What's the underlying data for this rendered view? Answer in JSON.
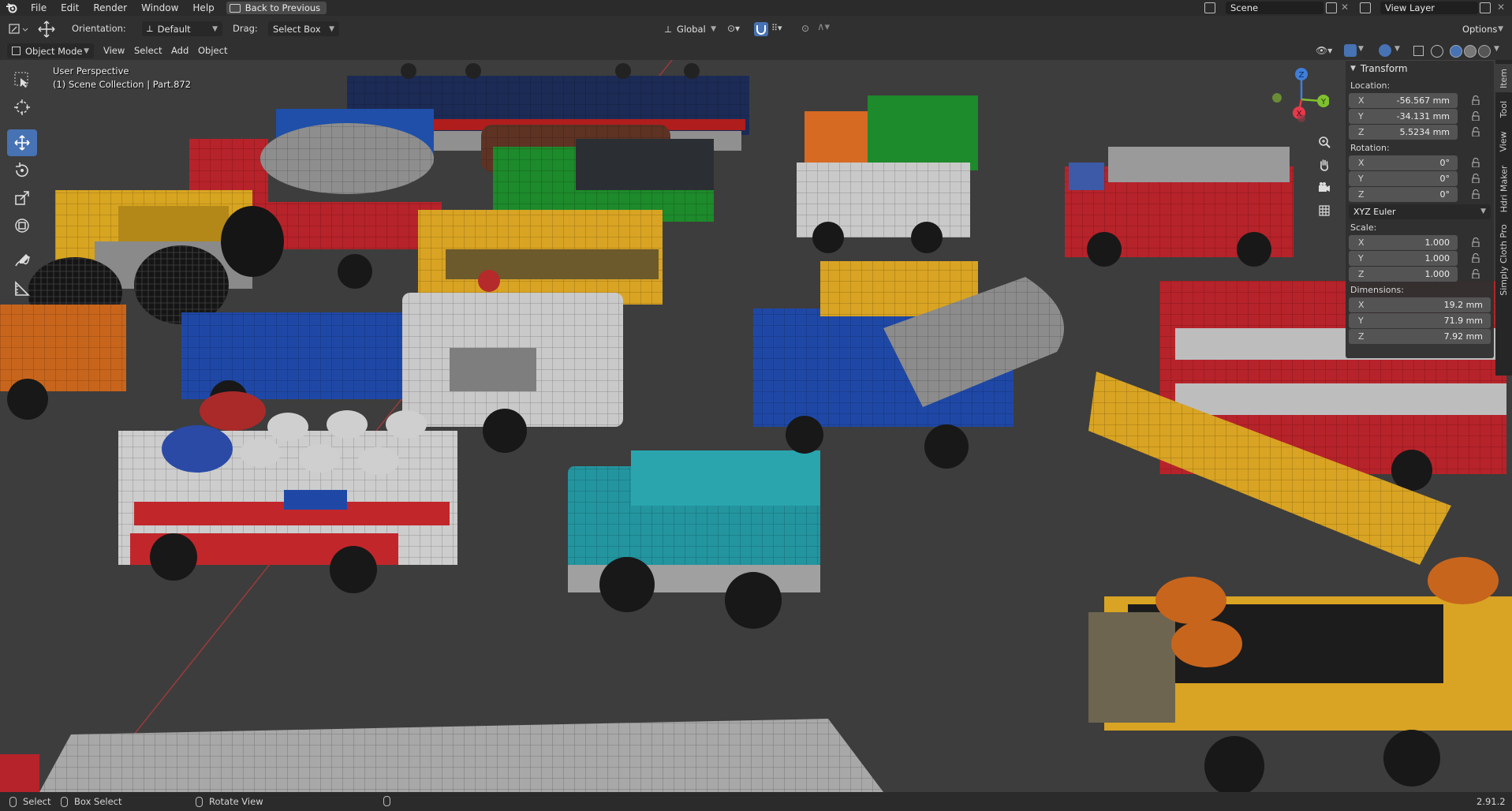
{
  "menu": {
    "items": [
      "File",
      "Edit",
      "Render",
      "Window",
      "Help"
    ],
    "back_button": "Back to Previous",
    "scene": "Scene",
    "view_layer": "View Layer"
  },
  "header": {
    "orientation_label": "Orientation:",
    "orientation_value": "Default",
    "drag_label": "Drag:",
    "drag_value": "Select Box",
    "transform_orientation": "Global",
    "options": "Options"
  },
  "header3": {
    "mode": "Object Mode",
    "menus": [
      "View",
      "Select",
      "Add",
      "Object"
    ]
  },
  "viewport": {
    "perspective": "User Perspective",
    "collection_info": "(1) Scene Collection | Part.872"
  },
  "gizmo": {
    "x": "X",
    "y": "Y",
    "z": "Z"
  },
  "npanel": {
    "title": "Transform",
    "location_label": "Location:",
    "location": [
      {
        "axis": "X",
        "value": "-56.567 mm"
      },
      {
        "axis": "Y",
        "value": "-34.131 mm"
      },
      {
        "axis": "Z",
        "value": "5.5234 mm"
      }
    ],
    "rotation_label": "Rotation:",
    "rotation": [
      {
        "axis": "X",
        "value": "0°"
      },
      {
        "axis": "Y",
        "value": "0°"
      },
      {
        "axis": "Z",
        "value": "0°"
      }
    ],
    "rotation_mode": "XYZ Euler",
    "scale_label": "Scale:",
    "scale": [
      {
        "axis": "X",
        "value": "1.000"
      },
      {
        "axis": "Y",
        "value": "1.000"
      },
      {
        "axis": "Z",
        "value": "1.000"
      }
    ],
    "dimensions_label": "Dimensions:",
    "dimensions": [
      {
        "axis": "X",
        "value": "19.2 mm"
      },
      {
        "axis": "Y",
        "value": "71.9 mm"
      },
      {
        "axis": "Z",
        "value": "7.92 mm"
      }
    ],
    "tabs": [
      "Item",
      "Tool",
      "View",
      "Hdri Maker",
      "Simply Cloth Pro"
    ]
  },
  "statusbar": {
    "select": "Select",
    "box_select": "Box Select",
    "rotate_view": "Rotate View",
    "version": "2.91.2"
  },
  "colors": {
    "accent": "#4772b3",
    "viewport_bg": "#3d3d3d",
    "axis_x": "#e8394a",
    "axis_y": "#7fc12e",
    "axis_z": "#3f7ed9"
  }
}
